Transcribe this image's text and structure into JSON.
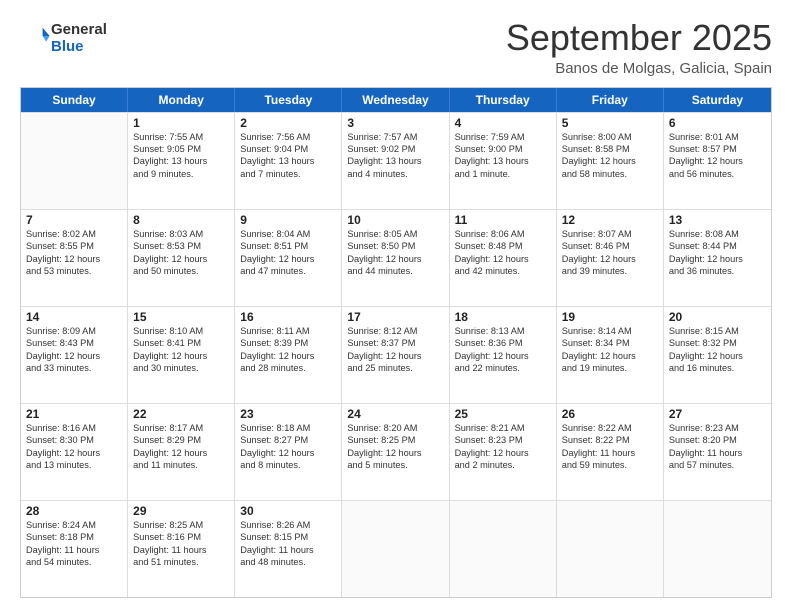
{
  "logo": {
    "general": "General",
    "blue": "Blue"
  },
  "header": {
    "month": "September 2025",
    "location": "Banos de Molgas, Galicia, Spain"
  },
  "days": [
    "Sunday",
    "Monday",
    "Tuesday",
    "Wednesday",
    "Thursday",
    "Friday",
    "Saturday"
  ],
  "weeks": [
    [
      {
        "day": "",
        "lines": []
      },
      {
        "day": "1",
        "lines": [
          "Sunrise: 7:55 AM",
          "Sunset: 9:05 PM",
          "Daylight: 13 hours",
          "and 9 minutes."
        ]
      },
      {
        "day": "2",
        "lines": [
          "Sunrise: 7:56 AM",
          "Sunset: 9:04 PM",
          "Daylight: 13 hours",
          "and 7 minutes."
        ]
      },
      {
        "day": "3",
        "lines": [
          "Sunrise: 7:57 AM",
          "Sunset: 9:02 PM",
          "Daylight: 13 hours",
          "and 4 minutes."
        ]
      },
      {
        "day": "4",
        "lines": [
          "Sunrise: 7:59 AM",
          "Sunset: 9:00 PM",
          "Daylight: 13 hours",
          "and 1 minute."
        ]
      },
      {
        "day": "5",
        "lines": [
          "Sunrise: 8:00 AM",
          "Sunset: 8:58 PM",
          "Daylight: 12 hours",
          "and 58 minutes."
        ]
      },
      {
        "day": "6",
        "lines": [
          "Sunrise: 8:01 AM",
          "Sunset: 8:57 PM",
          "Daylight: 12 hours",
          "and 56 minutes."
        ]
      }
    ],
    [
      {
        "day": "7",
        "lines": [
          "Sunrise: 8:02 AM",
          "Sunset: 8:55 PM",
          "Daylight: 12 hours",
          "and 53 minutes."
        ]
      },
      {
        "day": "8",
        "lines": [
          "Sunrise: 8:03 AM",
          "Sunset: 8:53 PM",
          "Daylight: 12 hours",
          "and 50 minutes."
        ]
      },
      {
        "day": "9",
        "lines": [
          "Sunrise: 8:04 AM",
          "Sunset: 8:51 PM",
          "Daylight: 12 hours",
          "and 47 minutes."
        ]
      },
      {
        "day": "10",
        "lines": [
          "Sunrise: 8:05 AM",
          "Sunset: 8:50 PM",
          "Daylight: 12 hours",
          "and 44 minutes."
        ]
      },
      {
        "day": "11",
        "lines": [
          "Sunrise: 8:06 AM",
          "Sunset: 8:48 PM",
          "Daylight: 12 hours",
          "and 42 minutes."
        ]
      },
      {
        "day": "12",
        "lines": [
          "Sunrise: 8:07 AM",
          "Sunset: 8:46 PM",
          "Daylight: 12 hours",
          "and 39 minutes."
        ]
      },
      {
        "day": "13",
        "lines": [
          "Sunrise: 8:08 AM",
          "Sunset: 8:44 PM",
          "Daylight: 12 hours",
          "and 36 minutes."
        ]
      }
    ],
    [
      {
        "day": "14",
        "lines": [
          "Sunrise: 8:09 AM",
          "Sunset: 8:43 PM",
          "Daylight: 12 hours",
          "and 33 minutes."
        ]
      },
      {
        "day": "15",
        "lines": [
          "Sunrise: 8:10 AM",
          "Sunset: 8:41 PM",
          "Daylight: 12 hours",
          "and 30 minutes."
        ]
      },
      {
        "day": "16",
        "lines": [
          "Sunrise: 8:11 AM",
          "Sunset: 8:39 PM",
          "Daylight: 12 hours",
          "and 28 minutes."
        ]
      },
      {
        "day": "17",
        "lines": [
          "Sunrise: 8:12 AM",
          "Sunset: 8:37 PM",
          "Daylight: 12 hours",
          "and 25 minutes."
        ]
      },
      {
        "day": "18",
        "lines": [
          "Sunrise: 8:13 AM",
          "Sunset: 8:36 PM",
          "Daylight: 12 hours",
          "and 22 minutes."
        ]
      },
      {
        "day": "19",
        "lines": [
          "Sunrise: 8:14 AM",
          "Sunset: 8:34 PM",
          "Daylight: 12 hours",
          "and 19 minutes."
        ]
      },
      {
        "day": "20",
        "lines": [
          "Sunrise: 8:15 AM",
          "Sunset: 8:32 PM",
          "Daylight: 12 hours",
          "and 16 minutes."
        ]
      }
    ],
    [
      {
        "day": "21",
        "lines": [
          "Sunrise: 8:16 AM",
          "Sunset: 8:30 PM",
          "Daylight: 12 hours",
          "and 13 minutes."
        ]
      },
      {
        "day": "22",
        "lines": [
          "Sunrise: 8:17 AM",
          "Sunset: 8:29 PM",
          "Daylight: 12 hours",
          "and 11 minutes."
        ]
      },
      {
        "day": "23",
        "lines": [
          "Sunrise: 8:18 AM",
          "Sunset: 8:27 PM",
          "Daylight: 12 hours",
          "and 8 minutes."
        ]
      },
      {
        "day": "24",
        "lines": [
          "Sunrise: 8:20 AM",
          "Sunset: 8:25 PM",
          "Daylight: 12 hours",
          "and 5 minutes."
        ]
      },
      {
        "day": "25",
        "lines": [
          "Sunrise: 8:21 AM",
          "Sunset: 8:23 PM",
          "Daylight: 12 hours",
          "and 2 minutes."
        ]
      },
      {
        "day": "26",
        "lines": [
          "Sunrise: 8:22 AM",
          "Sunset: 8:22 PM",
          "Daylight: 11 hours",
          "and 59 minutes."
        ]
      },
      {
        "day": "27",
        "lines": [
          "Sunrise: 8:23 AM",
          "Sunset: 8:20 PM",
          "Daylight: 11 hours",
          "and 57 minutes."
        ]
      }
    ],
    [
      {
        "day": "28",
        "lines": [
          "Sunrise: 8:24 AM",
          "Sunset: 8:18 PM",
          "Daylight: 11 hours",
          "and 54 minutes."
        ]
      },
      {
        "day": "29",
        "lines": [
          "Sunrise: 8:25 AM",
          "Sunset: 8:16 PM",
          "Daylight: 11 hours",
          "and 51 minutes."
        ]
      },
      {
        "day": "30",
        "lines": [
          "Sunrise: 8:26 AM",
          "Sunset: 8:15 PM",
          "Daylight: 11 hours",
          "and 48 minutes."
        ]
      },
      {
        "day": "",
        "lines": []
      },
      {
        "day": "",
        "lines": []
      },
      {
        "day": "",
        "lines": []
      },
      {
        "day": "",
        "lines": []
      }
    ]
  ]
}
